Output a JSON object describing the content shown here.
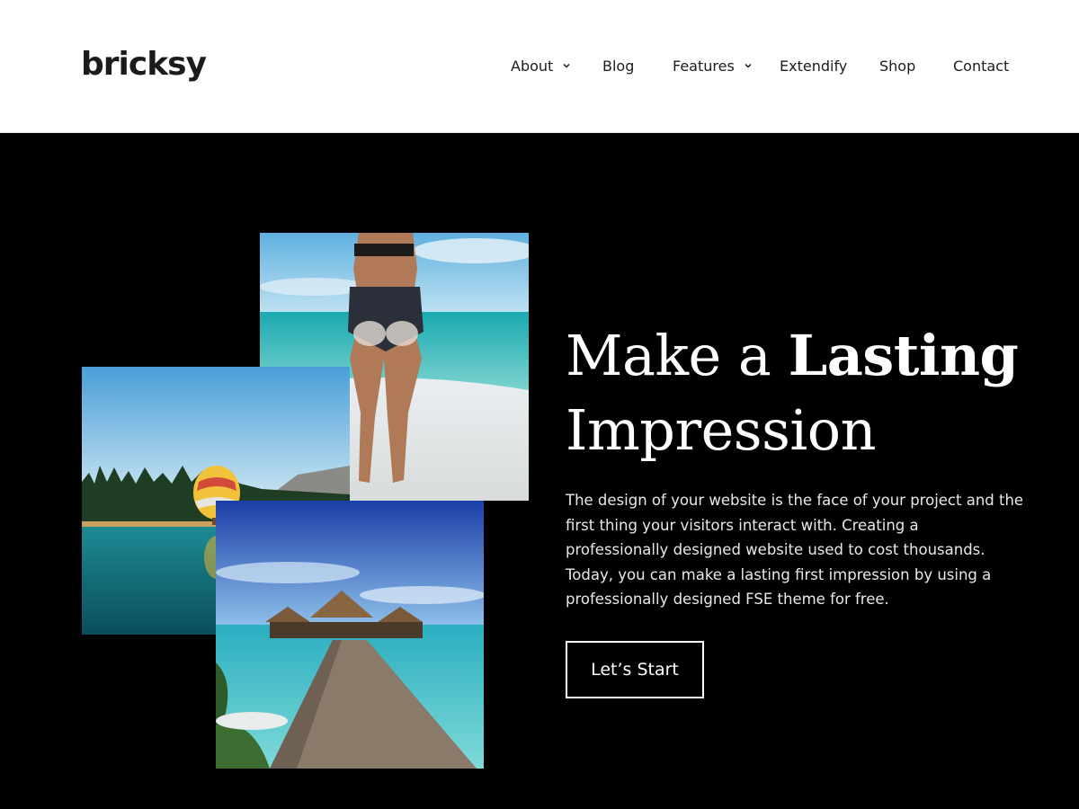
{
  "brand": {
    "logo_text": "bricksy"
  },
  "nav": {
    "items": [
      {
        "label": "About",
        "has_dropdown": true
      },
      {
        "label": "Blog",
        "has_dropdown": false
      },
      {
        "label": "Features",
        "has_dropdown": true
      },
      {
        "label": "Extendify",
        "has_dropdown": false
      },
      {
        "label": "Shop",
        "has_dropdown": false
      },
      {
        "label": "Contact",
        "has_dropdown": false
      }
    ]
  },
  "hero": {
    "headline_part1": "Make a ",
    "headline_bold": "Lasting",
    "headline_part2": "Impression",
    "description": "The design of your website is the face of your project and the first thing your visitors interact with. Creating a professionally designed website used to cost thousands. Today, you can make a lasting first impression by using a professionally designed FSE theme for free.",
    "cta_label": "Let’s Start",
    "images": [
      "beach-photo",
      "lake-balloon-photo",
      "overwater-pier-photo"
    ]
  },
  "colors": {
    "header_bg": "#ffffff",
    "hero_bg": "#000000",
    "text_dark": "#1b1b1b",
    "text_light": "#ffffff"
  }
}
